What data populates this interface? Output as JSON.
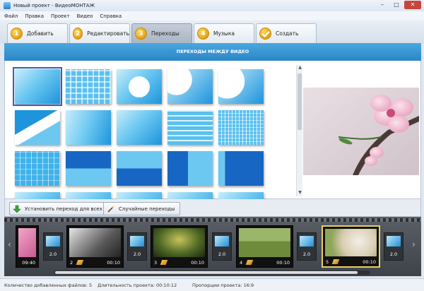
{
  "window": {
    "title": "Новый проект - ВидеоМОНТАЖ",
    "minimize": "–",
    "maximize": "□",
    "close": "✕"
  },
  "menu": [
    "Файл",
    "Правка",
    "Проект",
    "Видео",
    "Справка"
  ],
  "tabs": [
    {
      "num": "1",
      "label": "Добавить"
    },
    {
      "num": "2",
      "label": "Редактировать"
    },
    {
      "num": "3",
      "label": "Переходы"
    },
    {
      "num": "4",
      "label": "Музыка"
    },
    {
      "num": "",
      "label": "Создать"
    }
  ],
  "panel": {
    "title": "ПЕРЕХОДЫ МЕЖДУ ВИДЕО"
  },
  "actions": {
    "set_all": "Установить переход для всех",
    "random": "Случайные переходы"
  },
  "timeline": {
    "first": {
      "duration": "09:40"
    },
    "clips": [
      {
        "num": "2",
        "duration": "00:10"
      },
      {
        "num": "3",
        "duration": "00:10"
      },
      {
        "num": "4",
        "duration": "00:10"
      },
      {
        "num": "5",
        "duration": "00:10"
      }
    ],
    "transitions": [
      "2.0",
      "2.0",
      "2.0",
      "2.0",
      "2.0"
    ]
  },
  "status": {
    "files": "Количество добавленных файлов: 5",
    "duration": "Длительность проекта: 00:10:12",
    "ratio": "Пропорции проекта: 16:9"
  },
  "colors": {
    "accent": "#2a86c7",
    "selected_clip": "#e9cf63"
  }
}
